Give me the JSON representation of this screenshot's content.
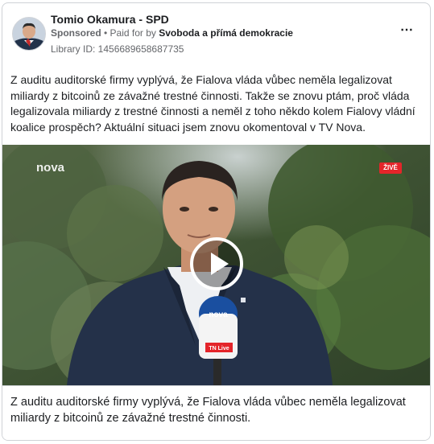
{
  "post": {
    "page_name": "Tomio Okamura - SPD",
    "sponsored": "Sponsored",
    "separator": " • ",
    "paid_for_by_prefix": "Paid for by ",
    "payer": "Svoboda a přímá demokracie",
    "library_id": "Library ID: 1456689658687735",
    "more_icon": "⋯",
    "body_text": "Z auditu auditorské firmy vyplývá, že Fialova vláda vůbec neměla legalizovat miliardy z bitcoinů ze závažné trestné činnosti. Takže se znovu ptám, proč vláda legalizovala miliardy z trestné činnosti a neměl z toho někdo kolem Fialovy vládní koalice prospěch? Aktuální situaci jsem znovu okomentoval v TV Nova."
  },
  "video": {
    "channel_logo_text": "nova",
    "live_badge": "ŽIVĚ",
    "mic_brand": "nova",
    "mic_sub": "TN Live",
    "play_icon": "play-icon"
  },
  "caption": {
    "text": "Z auditu auditorské firmy vyplývá, že Fialova vláda vůbec neměla legalizovat miliardy z bitcoinů ze závažné trestné činnosti."
  },
  "colors": {
    "border": "#cfd2d6",
    "text": "#1c1e21",
    "secondary_text": "#65676b",
    "live_red": "#e4252a",
    "mic_blue": "#1a4fa0"
  }
}
